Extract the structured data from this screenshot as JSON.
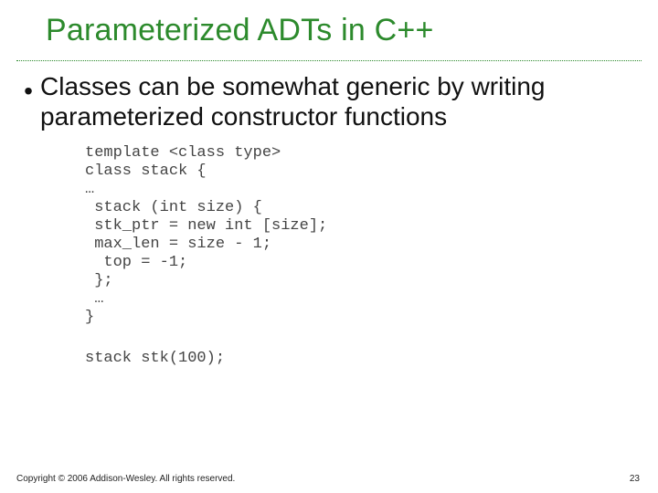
{
  "title": "Parameterized ADTs in C++",
  "bullet_glyph": "•",
  "bullet1": "Classes can be somewhat generic by writing parameterized constructor functions",
  "code_lines": [
    "template <class type>",
    "class stack {",
    "…",
    " stack (int size) {",
    " stk_ptr = new int [size];",
    " max_len = size - 1;",
    "  top = -1;",
    " };",
    " …",
    "}"
  ],
  "sample_line": "stack stk(100);",
  "copyright": "Copyright © 2006 Addison-Wesley. All rights reserved.",
  "page_number": "23"
}
